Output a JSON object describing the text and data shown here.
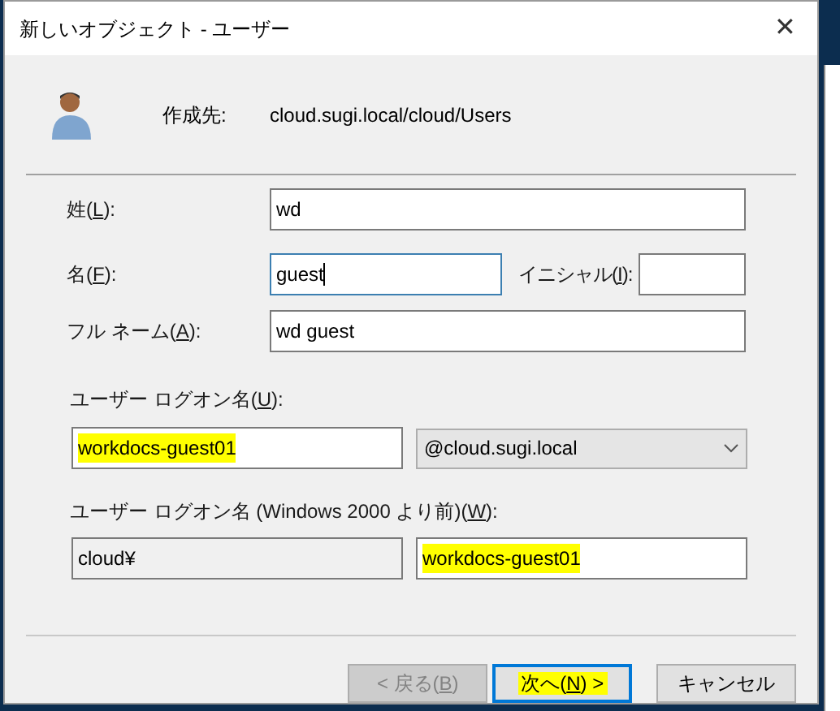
{
  "window": {
    "title": "新しいオブジェクト - ユーザー",
    "close": "✕"
  },
  "destination": {
    "label": "作成先:",
    "path": "cloud.sugi.local/cloud/Users"
  },
  "last_name": {
    "before": "姓(",
    "key": "L",
    "after": "):",
    "value": "wd",
    "focused": false
  },
  "first_name": {
    "before": "名(",
    "key": "F",
    "after": "):",
    "value": "guest",
    "focused": true
  },
  "initials": {
    "before": "イニシャル(",
    "key": "I",
    "after": "):"
  },
  "full_name": {
    "before": "フル ネーム(",
    "key": "A",
    "after": "):",
    "value": "wd guest",
    "focused": false
  },
  "logon_name": {
    "before": "ユーザー ログオン名(",
    "key": "U",
    "after": "):",
    "value": "workdocs-guest01",
    "highlighted": true,
    "domain": "@cloud.sugi.local"
  },
  "logon_name_pre2000": {
    "before": "ユーザー ログオン名 (Windows 2000 より前)(",
    "key": "W",
    "after": "):",
    "domain": "cloud¥",
    "value": "workdocs-guest01",
    "highlighted": true
  },
  "buttons": [
    {
      "before": "< 戻る(",
      "key": "B",
      "after": ")",
      "disabled": true,
      "default": false,
      "highlighted": false
    },
    {
      "before": "次へ(",
      "key": "N",
      "after": ") >",
      "disabled": false,
      "default": true,
      "highlighted": true
    },
    {
      "before": "キャンセル",
      "disabled": false,
      "default": false,
      "highlighted": false
    }
  ]
}
